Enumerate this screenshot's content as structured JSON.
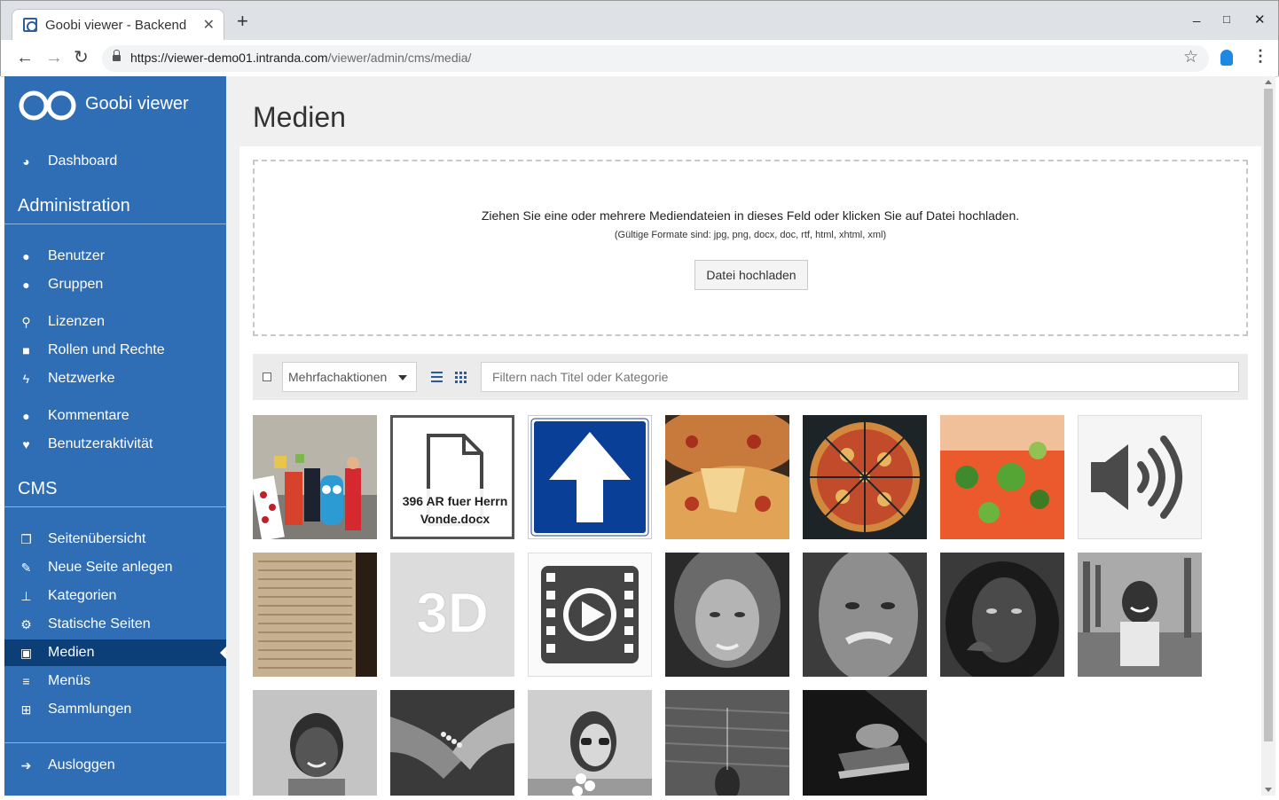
{
  "browser": {
    "tab_title": "Goobi viewer - Backend",
    "tab_close": "✕",
    "new_tab": "+",
    "url_host": "https://viewer-demo01.intranda.com",
    "url_path": "/viewer/admin/cms/media/",
    "back": "←",
    "forward": "→",
    "reload": "↻",
    "star": "☆",
    "menu": "⋮",
    "minimize": "_",
    "maximize": "□",
    "close": "✕"
  },
  "sidebar": {
    "brand": "Goobi viewer",
    "dashboard": "Dashboard",
    "admin_heading": "Administration",
    "admin_items": [
      {
        "label": "Benutzer",
        "icon": "user-icon",
        "glyph": "●"
      },
      {
        "label": "Gruppen",
        "icon": "users-icon",
        "glyph": "●"
      },
      {
        "label": "Lizenzen",
        "icon": "key-icon",
        "glyph": "⚲"
      },
      {
        "label": "Rollen und Rechte",
        "icon": "lock-icon",
        "glyph": "■"
      },
      {
        "label": "Netzwerke",
        "icon": "bolt-icon",
        "glyph": "ϟ"
      },
      {
        "label": "Kommentare",
        "icon": "comments-icon",
        "glyph": "●"
      },
      {
        "label": "Benutzeraktivität",
        "icon": "heartbeat-icon",
        "glyph": "♥"
      }
    ],
    "cms_heading": "CMS",
    "cms_items": [
      {
        "label": "Seitenübersicht",
        "icon": "pages-icon",
        "glyph": "❐"
      },
      {
        "label": "Neue Seite anlegen",
        "icon": "edit-icon",
        "glyph": "✎"
      },
      {
        "label": "Kategorien",
        "icon": "thumbtack-icon",
        "glyph": "⊥"
      },
      {
        "label": "Statische Seiten",
        "icon": "cogs-icon",
        "glyph": "⚙"
      },
      {
        "label": "Medien",
        "icon": "image-icon",
        "glyph": "▣"
      },
      {
        "label": "Menüs",
        "icon": "bars-icon",
        "glyph": "≡"
      },
      {
        "label": "Sammlungen",
        "icon": "collection-icon",
        "glyph": "⊞"
      }
    ],
    "logout": "Ausloggen",
    "active": "Medien"
  },
  "main": {
    "title": "Medien",
    "dropzone": {
      "text": "Ziehen Sie eine oder mehrere Mediendateien in dieses Feld oder klicken Sie auf Datei hochladen.",
      "hint": "(Gültige Formate sind: jpg, png, docx, doc, rtf, html, xhtml, xml)",
      "button": "Datei hochladen"
    },
    "toolbar": {
      "bulk_actions": "Mehrfachaktionen",
      "filter_placeholder": "Filtern nach Titel oder Kategorie"
    },
    "media": [
      {
        "name": "costume-group-photo",
        "type": "image"
      },
      {
        "name": "docx-file",
        "type": "document",
        "label": "396 AR fuer Herrn Vonde.docx"
      },
      {
        "name": "arrow-sign",
        "type": "image"
      },
      {
        "name": "pizza-slice",
        "type": "image"
      },
      {
        "name": "pizza-top-view",
        "type": "image"
      },
      {
        "name": "salad-closeup",
        "type": "image"
      },
      {
        "name": "audio-file",
        "type": "audio"
      },
      {
        "name": "old-manuscript",
        "type": "image"
      },
      {
        "name": "3d-object",
        "type": "3d",
        "label": "3D"
      },
      {
        "name": "video-file",
        "type": "video"
      },
      {
        "name": "elderly-woman-portrait",
        "type": "image"
      },
      {
        "name": "old-man-portrait",
        "type": "image"
      },
      {
        "name": "hooded-man-portrait",
        "type": "image"
      },
      {
        "name": "boy-smiling",
        "type": "image"
      },
      {
        "name": "child-portrait",
        "type": "image"
      },
      {
        "name": "holding-hands",
        "type": "image"
      },
      {
        "name": "woman-sunglasses",
        "type": "image"
      },
      {
        "name": "sea-photo",
        "type": "image"
      },
      {
        "name": "reading-book",
        "type": "image"
      }
    ]
  }
}
